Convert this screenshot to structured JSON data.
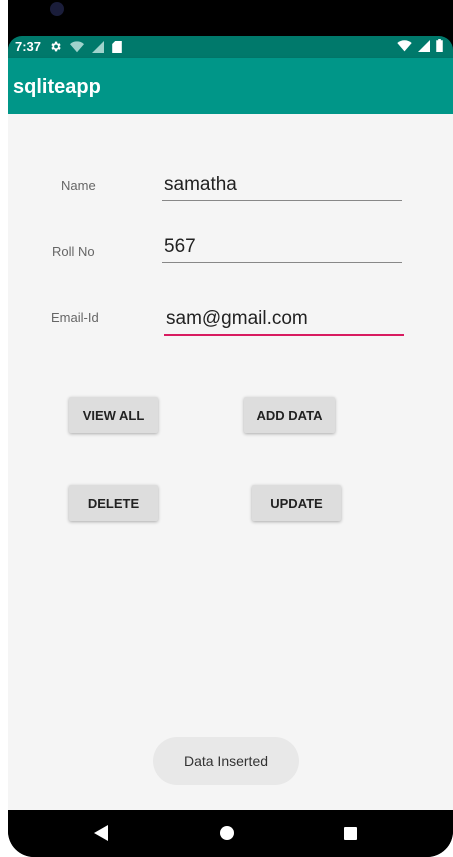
{
  "status_bar": {
    "time": "7:37",
    "left_icons": [
      "gear-icon",
      "wifi-question-icon",
      "signal-question-icon",
      "sd-card-icon"
    ],
    "right_icons": [
      "wifi-icon",
      "cell-signal-icon",
      "battery-icon"
    ]
  },
  "app_bar": {
    "title": "sqliteapp"
  },
  "form": {
    "name": {
      "label": "Name",
      "value": "samatha"
    },
    "roll_no": {
      "label": "Roll No",
      "value": "567"
    },
    "email": {
      "label": "Email-Id",
      "value": "sam@gmail.com"
    }
  },
  "buttons": {
    "view_all": "VIEW ALL",
    "add_data": "ADD DATA",
    "delete": "DELETE",
    "update": "UPDATE"
  },
  "toast": {
    "message": "Data Inserted"
  },
  "nav_bar": {
    "icons": [
      "back-icon",
      "home-icon",
      "recents-icon"
    ]
  },
  "colors": {
    "primary": "#009688",
    "primary_dark": "#00796b",
    "accent": "#d81b60",
    "background": "#f5f5f5"
  }
}
